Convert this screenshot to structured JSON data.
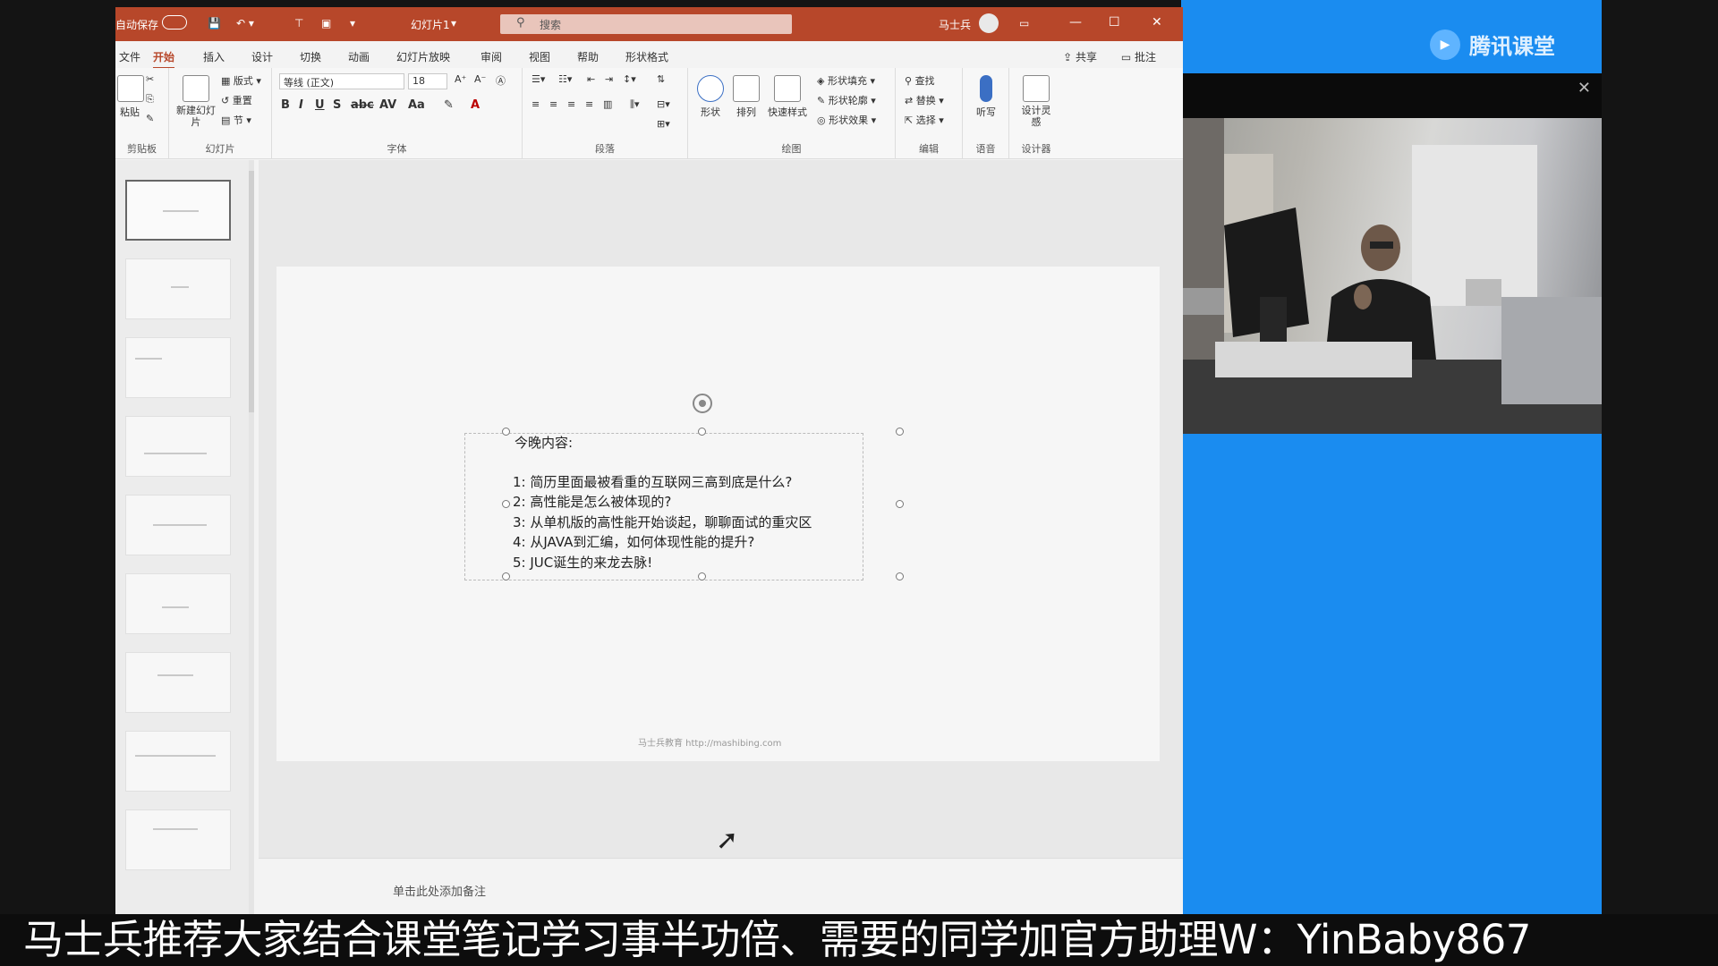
{
  "titlebar": {
    "autosave": "自动保存",
    "autosave_state": "关",
    "filename": "幻灯片1",
    "search_placeholder": "搜索",
    "user": "马士兵"
  },
  "tabs": {
    "items": [
      "文件",
      "开始",
      "插入",
      "设计",
      "切换",
      "动画",
      "幻灯片放映",
      "审阅",
      "视图",
      "帮助",
      "形状格式"
    ],
    "active": "开始",
    "share": "共享",
    "comment": "批注"
  },
  "ribbon": {
    "clipboard_label": "剪贴板",
    "paste": "粘贴",
    "slides_label": "幻灯片",
    "new_slide": "新建幻灯片",
    "layout": "版式",
    "reset": "重置",
    "section": "节",
    "font_label": "字体",
    "font_name": "等线 (正文)",
    "font_size": "18",
    "paragraph_label": "段落",
    "drawing_label": "绘图",
    "shapes": "形状",
    "arrange": "排列",
    "quick_styles": "快速样式",
    "shape_fill": "形状填充",
    "shape_outline": "形状轮廓",
    "shape_effects": "形状效果",
    "editing_label": "编辑",
    "find": "查找",
    "replace": "替换",
    "select": "选择",
    "voice_label": "语音",
    "dictate": "听写",
    "designer_label": "设计器",
    "design_ideas": "设计灵感"
  },
  "slide": {
    "heading": "今晚内容:",
    "items": [
      "1:   简历里面最被看重的互联网三高到底是什么?",
      "2:   高性能是怎么被体现的?",
      "3:   从单机版的高性能开始谈起，聊聊面试的重灾区",
      "4:   从JAVA到汇编，如何体现性能的提升?",
      "5:   JUC诞生的来龙去脉!"
    ],
    "footer": "马士兵教育 http://mashibing.com"
  },
  "notes_placeholder": "单击此处添加备注",
  "classroom_logo": "腾讯课堂",
  "banner": "马士兵推荐大家结合课堂笔记学习事半功倍、需要的同学加官方助理W：YinBaby867"
}
